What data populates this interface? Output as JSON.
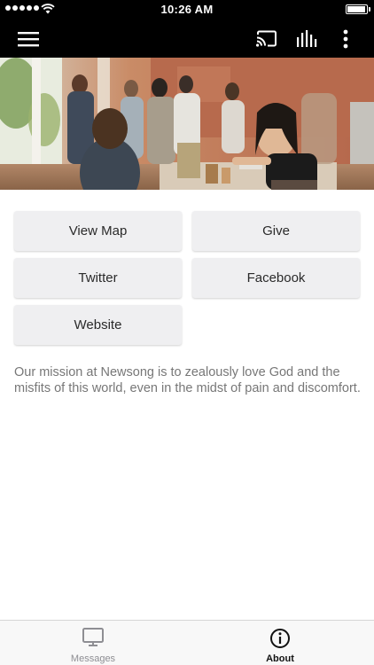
{
  "status_bar": {
    "time": "10:26 AM",
    "signal_icon": "signal-dots-icon",
    "wifi_icon": "wifi-icon",
    "battery_icon": "battery-icon",
    "battery_level": 0.95
  },
  "toolbar": {
    "menu_icon": "hamburger-menu-icon",
    "cast_icon": "cast-icon",
    "audio_icon": "audio-bars-icon",
    "more_icon": "more-vertical-icon"
  },
  "hero": {
    "image": "photo of people gathered around a coffee table"
  },
  "buttons": {
    "view_map": "View Map",
    "give": "Give",
    "twitter": "Twitter",
    "facebook": "Facebook",
    "website": "Website"
  },
  "mission_text": "Our mission at Newsong is to zealously love God and the misfits of this world, even in the midst of pain and discomfort.",
  "tab_bar": {
    "tabs": [
      {
        "label": "Messages",
        "icon": "monitor-icon",
        "active": false
      },
      {
        "label": "About",
        "icon": "info-icon",
        "active": true
      }
    ]
  },
  "colors": {
    "toolbar_bg": "#000000",
    "button_bg": "#efeff1",
    "mission_text": "#777777",
    "tab_active": "#111111",
    "tab_inactive": "#8e8e93"
  }
}
